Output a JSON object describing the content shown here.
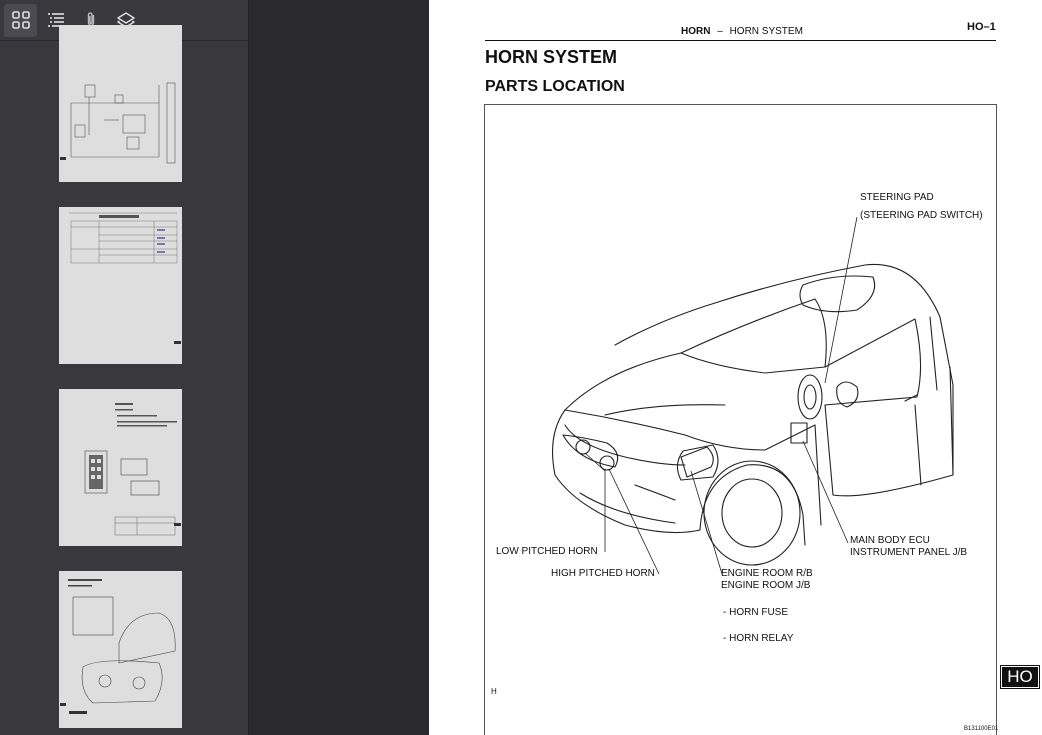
{
  "toolbar": {
    "buttons": [
      {
        "name": "thumbnails",
        "icon": "grid-icon"
      },
      {
        "name": "outline",
        "icon": "list-icon"
      },
      {
        "name": "attachments",
        "icon": "paperclip-icon"
      },
      {
        "name": "layers",
        "icon": "layers-icon"
      }
    ]
  },
  "sidebar": {
    "thumbnails": [
      {
        "page": "wiring-diagram"
      },
      {
        "page": "problem-symptoms-table"
      },
      {
        "page": "horn-relay"
      },
      {
        "page": "low-pitched-horn"
      }
    ]
  },
  "page": {
    "header_section": "HORN",
    "header_dash": "–",
    "header_system": "HORN SYSTEM",
    "page_number": "HO–1",
    "title": "HORN SYSTEM",
    "subtitle": "PARTS LOCATION",
    "labels": {
      "steering_pad": "STEERING PAD",
      "steering_pad_switch": "(STEERING PAD SWITCH)",
      "main_body_ecu": "MAIN BODY ECU",
      "instrument_panel_jb": "INSTRUMENT PANEL J/B",
      "low_pitched_horn": "LOW PITCHED HORN",
      "high_pitched_horn": "HIGH PITCHED HORN",
      "engine_room_rb": "ENGINE ROOM R/B",
      "engine_room_jb": "ENGINE ROOM J/B",
      "horn_fuse": "- HORN FUSE",
      "horn_relay": "- HORN RELAY"
    },
    "figure_mark": "H",
    "figure_code": "B131100E01",
    "side_tab": "HO"
  },
  "colors": {
    "sidebar_bg": "#38383d",
    "viewer_bg": "#2a2a2e",
    "page_bg": "#ffffff",
    "icon": "#e0e0e0"
  }
}
